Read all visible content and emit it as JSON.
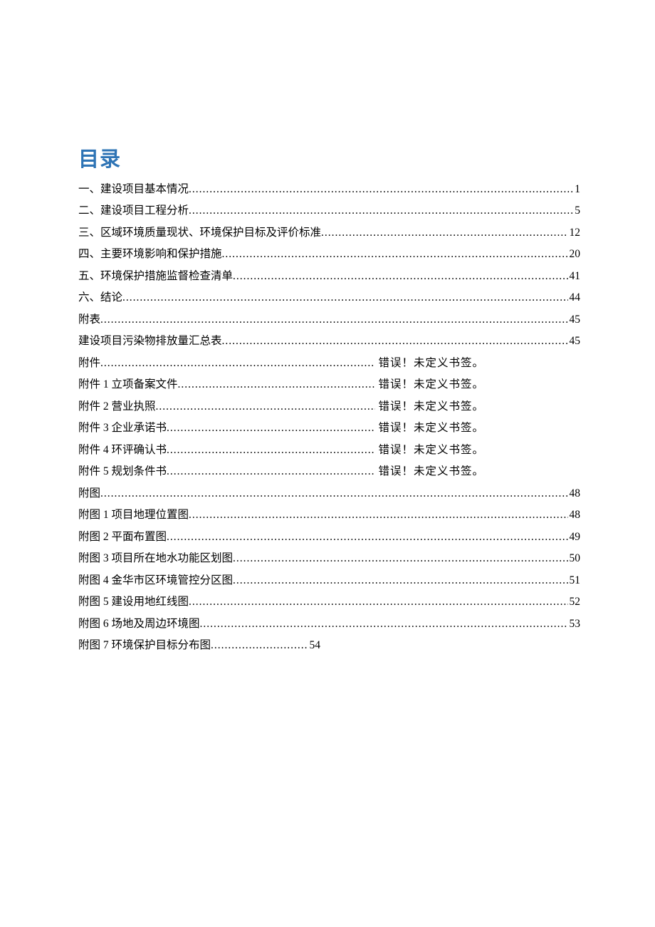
{
  "title": "目录",
  "entries": [
    {
      "label": "一、建设项目基本情况",
      "page": "1",
      "error": null
    },
    {
      "label": "二、建设项目工程分析",
      "page": "5",
      "error": null
    },
    {
      "label": "三、区域环境质量现状、环境保护目标及评价标准",
      "page": "12",
      "error": null
    },
    {
      "label": "四、主要环境影响和保护措施",
      "page": "20",
      "error": null
    },
    {
      "label": "五、环境保护措施监督检查清单",
      "page": "41",
      "error": null
    },
    {
      "label": "六、结论",
      "page": "44",
      "error": null
    },
    {
      "label": "附表",
      "page": "45",
      "error": null
    },
    {
      "label": "建设项目污染物排放量汇总表",
      "page": "45",
      "error": null
    },
    {
      "label": "附件",
      "page": null,
      "error": "错误！未定义书签。"
    },
    {
      "label": "附件 1 立项备案文件 ",
      "page": null,
      "error": "错误！未定义书签。"
    },
    {
      "label": "附件 2 营业执照 ",
      "page": null,
      "error": "错误！未定义书签。"
    },
    {
      "label": "附件 3 企业承诺书 ",
      "page": null,
      "error": "错误！未定义书签。"
    },
    {
      "label": "附件 4 环评确认书 ",
      "page": null,
      "error": "错误！未定义书签。"
    },
    {
      "label": "附件 5 规划条件书 ",
      "page": null,
      "error": "错误！未定义书签。"
    },
    {
      "label": "附图",
      "page": "48",
      "error": null
    },
    {
      "label": "附图 1 项目地理位置图",
      "page": "48",
      "error": null
    },
    {
      "label": "附图 2 平面布置图",
      "page": "49",
      "error": null
    },
    {
      "label": "附图 3 项目所在地水功能区划图",
      "page": "50",
      "error": null
    },
    {
      "label": "附图 4 金华市区环境管控分区图",
      "page": "51",
      "error": null
    },
    {
      "label": "附图 5 建设用地红线图",
      "page": "52",
      "error": null
    },
    {
      "label": "附图 6 场地及周边环境图",
      "page": "53",
      "error": null
    },
    {
      "label": "附图 7 环境保护目标分布图",
      "page": "54",
      "error": null,
      "short": true
    }
  ]
}
